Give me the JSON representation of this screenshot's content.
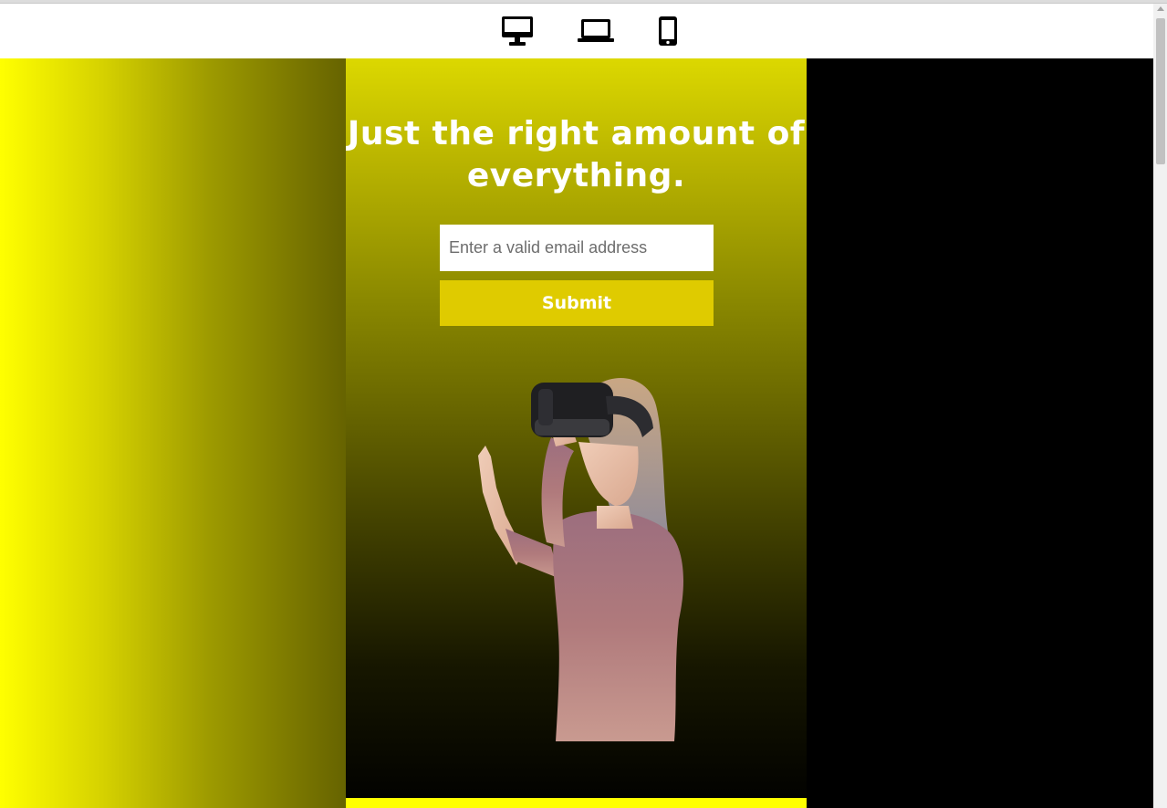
{
  "toolbar": {
    "devices": [
      {
        "name": "desktop",
        "icon": "desktop-monitor-icon"
      },
      {
        "name": "laptop",
        "icon": "laptop-icon"
      },
      {
        "name": "mobile",
        "icon": "mobile-phone-icon"
      }
    ]
  },
  "hero": {
    "headline": "Just the right amount of everything.",
    "email_placeholder": "Enter a valid email address",
    "email_value": "",
    "submit_label": "Submit",
    "image_icon": "vr-headset-woman-image"
  },
  "colors": {
    "accent_yellow": "#ffff00",
    "submit_bg": "#dfcb00",
    "right_panel": "#000000",
    "headline_text": "#ffffff"
  }
}
